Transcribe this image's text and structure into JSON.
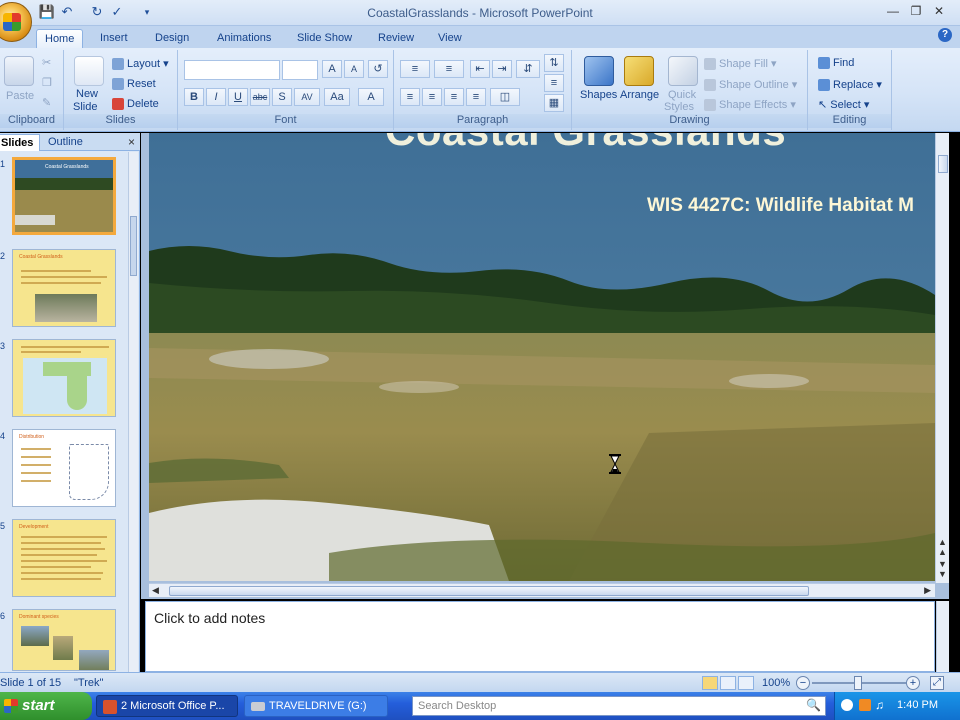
{
  "window": {
    "title": "CoastalGrasslands - Microsoft PowerPoint"
  },
  "tabs": [
    "Home",
    "Insert",
    "Design",
    "Animations",
    "Slide Show",
    "Review",
    "View"
  ],
  "ribbon": {
    "clipboard": {
      "paste": "Paste",
      "label": "Clipboard"
    },
    "slides": {
      "new_slide_1": "New",
      "new_slide_2": "Slide",
      "layout": "Layout",
      "reset": "Reset",
      "delete": "Delete",
      "label": "Slides"
    },
    "font": {
      "label": "Font",
      "bold": "B",
      "italic": "I",
      "underline": "U",
      "strike": "abc",
      "shadow": "S",
      "spacing": "AV",
      "case": "Aa",
      "color": "A",
      "grow": "A",
      "shrink": "A"
    },
    "paragraph": {
      "label": "Paragraph"
    },
    "drawing": {
      "shapes": "Shapes",
      "arrange": "Arrange",
      "quick_styles_1": "Quick",
      "quick_styles_2": "Styles",
      "shape_fill": "Shape Fill",
      "shape_outline": "Shape Outline",
      "shape_effects": "Shape Effects",
      "label": "Drawing"
    },
    "editing": {
      "find": "Find",
      "replace": "Replace",
      "select": "Select",
      "label": "Editing"
    }
  },
  "left_pane": {
    "tab_slides": "Slides",
    "tab_outline": "Outline",
    "close": "×",
    "thumbs": [
      {
        "num": "1",
        "title": "Coastal Grasslands"
      },
      {
        "num": "2",
        "title": "Coastal Grasslands"
      },
      {
        "num": "3",
        "title": ""
      },
      {
        "num": "4",
        "title": "Distribution"
      },
      {
        "num": "5",
        "title": "Development"
      },
      {
        "num": "6",
        "title": "Dominant species"
      }
    ]
  },
  "slide": {
    "title": "Coastal Grasslands",
    "subtitle": "WIS 4427C: Wildlife Habitat M"
  },
  "notes": {
    "placeholder": "Click to add notes"
  },
  "status": {
    "slide_info": "Slide 1 of 15",
    "theme": "\"Trek\"",
    "zoom": "100%",
    "zoom_minus": "−",
    "zoom_plus": "+"
  },
  "taskbar": {
    "start": "start",
    "task1": "2 Microsoft Office P...",
    "task2": "TRAVELDRIVE (G:)",
    "search_placeholder": "Search Desktop",
    "clock": "1:40 PM"
  }
}
